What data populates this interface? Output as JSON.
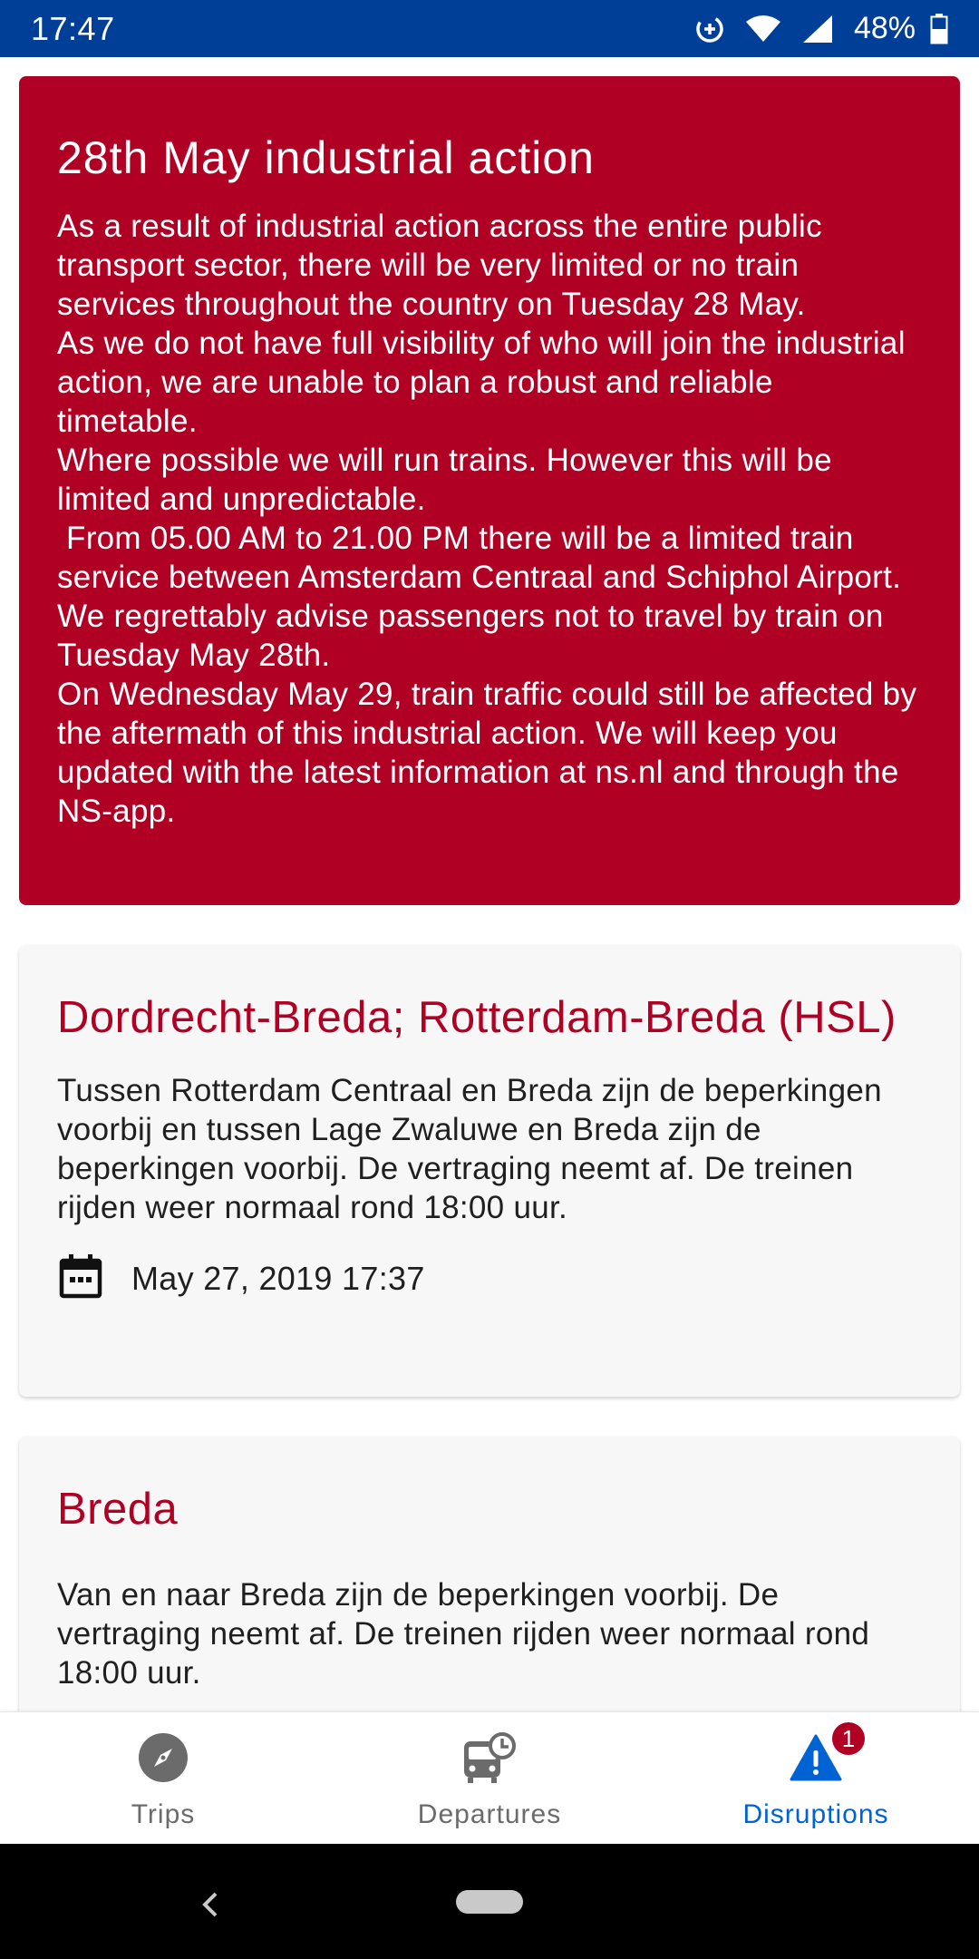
{
  "status_bar": {
    "time": "17:47",
    "battery_percent": "48%",
    "icons": [
      "data-saver-icon",
      "wifi-icon",
      "signal-icon",
      "battery-icon"
    ],
    "background_color": "#003f98"
  },
  "alert": {
    "title": "28th May industrial action",
    "paragraphs": [
      "As a result of industrial action across the entire public transport sector, there will be very limited or no train services throughout the country on Tuesday 28 May.",
      "As we do not have full visibility of who will join the industrial action, we are unable to plan a robust and reliable timetable.",
      "Where possible we will run trains. However this will be limited and unpredictable.",
      " From 05.00 AM to 21.00 PM there will be a limited train service between Amsterdam Centraal and Schiphol Airport.",
      "We regrettably advise passengers not to travel by train on Tuesday May 28th.",
      "On Wednesday May 29, train traffic could still be affected by the aftermath of this industrial action. We will keep you updated with the latest information at ns.nl and through the NS-app."
    ],
    "background_color": "#b00024"
  },
  "disruptions": [
    {
      "title": "Dordrecht-Breda; Rotterdam-Breda (HSL)",
      "body": "Tussen Rotterdam Centraal en Breda zijn de beperkingen voorbij en tussen Lage Zwaluwe en Breda zijn de beperkingen voorbij. De vertraging neemt af. De treinen rijden weer normaal rond 18:00 uur.",
      "date": "May 27, 2019 17:37",
      "date_icon": "calendar-icon"
    },
    {
      "title": "Breda",
      "body": "Van en naar Breda zijn de beperkingen voorbij. De vertraging neemt af. De treinen rijden weer normaal rond 18:00 uur."
    }
  ],
  "bottom_nav": {
    "items": [
      {
        "label": "Trips",
        "icon": "compass-icon",
        "active": false
      },
      {
        "label": "Departures",
        "icon": "train-clock-icon",
        "active": false
      },
      {
        "label": "Disruptions",
        "icon": "warning-icon",
        "active": true,
        "badge": "1"
      }
    ],
    "active_color": "#0063d3",
    "inactive_color": "#6b6b6b"
  },
  "system_nav": {
    "icons": [
      "back-icon",
      "home-pill-icon"
    ]
  }
}
